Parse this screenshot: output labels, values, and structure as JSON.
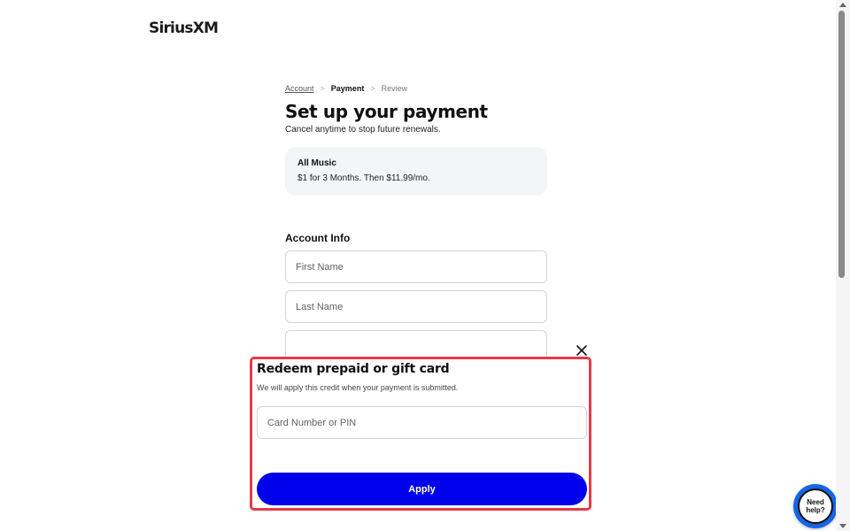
{
  "header": {
    "logo_text": "SiriusXM"
  },
  "breadcrumb": {
    "items": [
      {
        "label": "Account",
        "state": "link"
      },
      {
        "label": "Payment",
        "state": "current"
      },
      {
        "label": "Review",
        "state": "upcoming"
      }
    ],
    "separator": ">"
  },
  "page": {
    "title": "Set up your payment",
    "subtitle": "Cancel anytime to stop future renewals."
  },
  "plan": {
    "name": "All Music",
    "price": "$1 for 3 Months. Then $11.99/mo."
  },
  "account_info": {
    "heading": "Account Info",
    "first_name": {
      "value": "",
      "placeholder": "First Name"
    },
    "last_name": {
      "value": "",
      "placeholder": "Last Name"
    }
  },
  "modal": {
    "title": "Redeem prepaid or gift card",
    "subtitle": "We will apply this credit when your payment is submitted.",
    "card_field": {
      "value": "",
      "placeholder": "Card Number or PIN"
    },
    "apply_label": "Apply",
    "close_icon": "close-icon",
    "highlight_color": "#e63946"
  },
  "help_widget": {
    "label": "Need help?",
    "color": "#1565e6"
  },
  "colors": {
    "primary": "#0000eb",
    "card_bg": "#f4f5f7"
  }
}
